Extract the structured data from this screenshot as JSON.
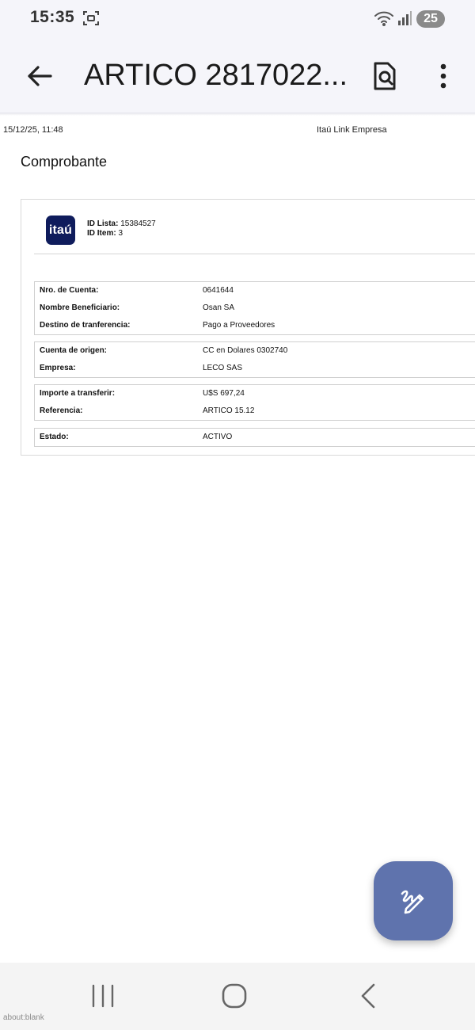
{
  "status_bar": {
    "time": "15:35",
    "battery": "25",
    "icons": [
      "screenshot-icon",
      "wifi-icon",
      "signal-icon",
      "battery-icon"
    ]
  },
  "app_bar": {
    "title": "ARTICO 2817022...",
    "icons": [
      "back-arrow-icon",
      "document-search-icon",
      "more-vert-icon"
    ]
  },
  "document": {
    "print_date": "15/12/25, 11:48",
    "print_source": "Itaú Link Empresa",
    "heading": "Comprobante",
    "logo_text": "itaú",
    "id_lista_label": "ID Lista:",
    "id_lista_value": "15384527",
    "id_item_label": "ID Item:",
    "id_item_value": "3",
    "groups": [
      {
        "rows": [
          {
            "label": "Nro. de Cuenta:",
            "value": "0641644"
          },
          {
            "label": "Nombre Beneficiario:",
            "value": "Osan SA"
          },
          {
            "label": "Destino de tranferencia:",
            "value": "Pago a Proveedores"
          }
        ]
      },
      {
        "rows": [
          {
            "label": "Cuenta de origen:",
            "value": "CC en Dolares 0302740"
          },
          {
            "label": "Empresa:",
            "value": "LECO SAS"
          }
        ]
      },
      {
        "rows": [
          {
            "label": "Importe a transferir:",
            "value": "U$S 697,24"
          },
          {
            "label": "Referencia:",
            "value": "ARTICO 15.12"
          }
        ]
      },
      {
        "rows": [
          {
            "label": "Estado:",
            "value": "ACTIVO"
          }
        ]
      }
    ]
  },
  "fab": {
    "icon": "signature-edit-icon"
  },
  "nav_bar": {
    "url": "about:blank",
    "icons": [
      "recents-icon",
      "home-icon",
      "back-icon"
    ]
  },
  "colors": {
    "fab": "#5f73ad",
    "logo_bg": "#0f1c5c",
    "bars_bg": "#f5f5fa"
  }
}
